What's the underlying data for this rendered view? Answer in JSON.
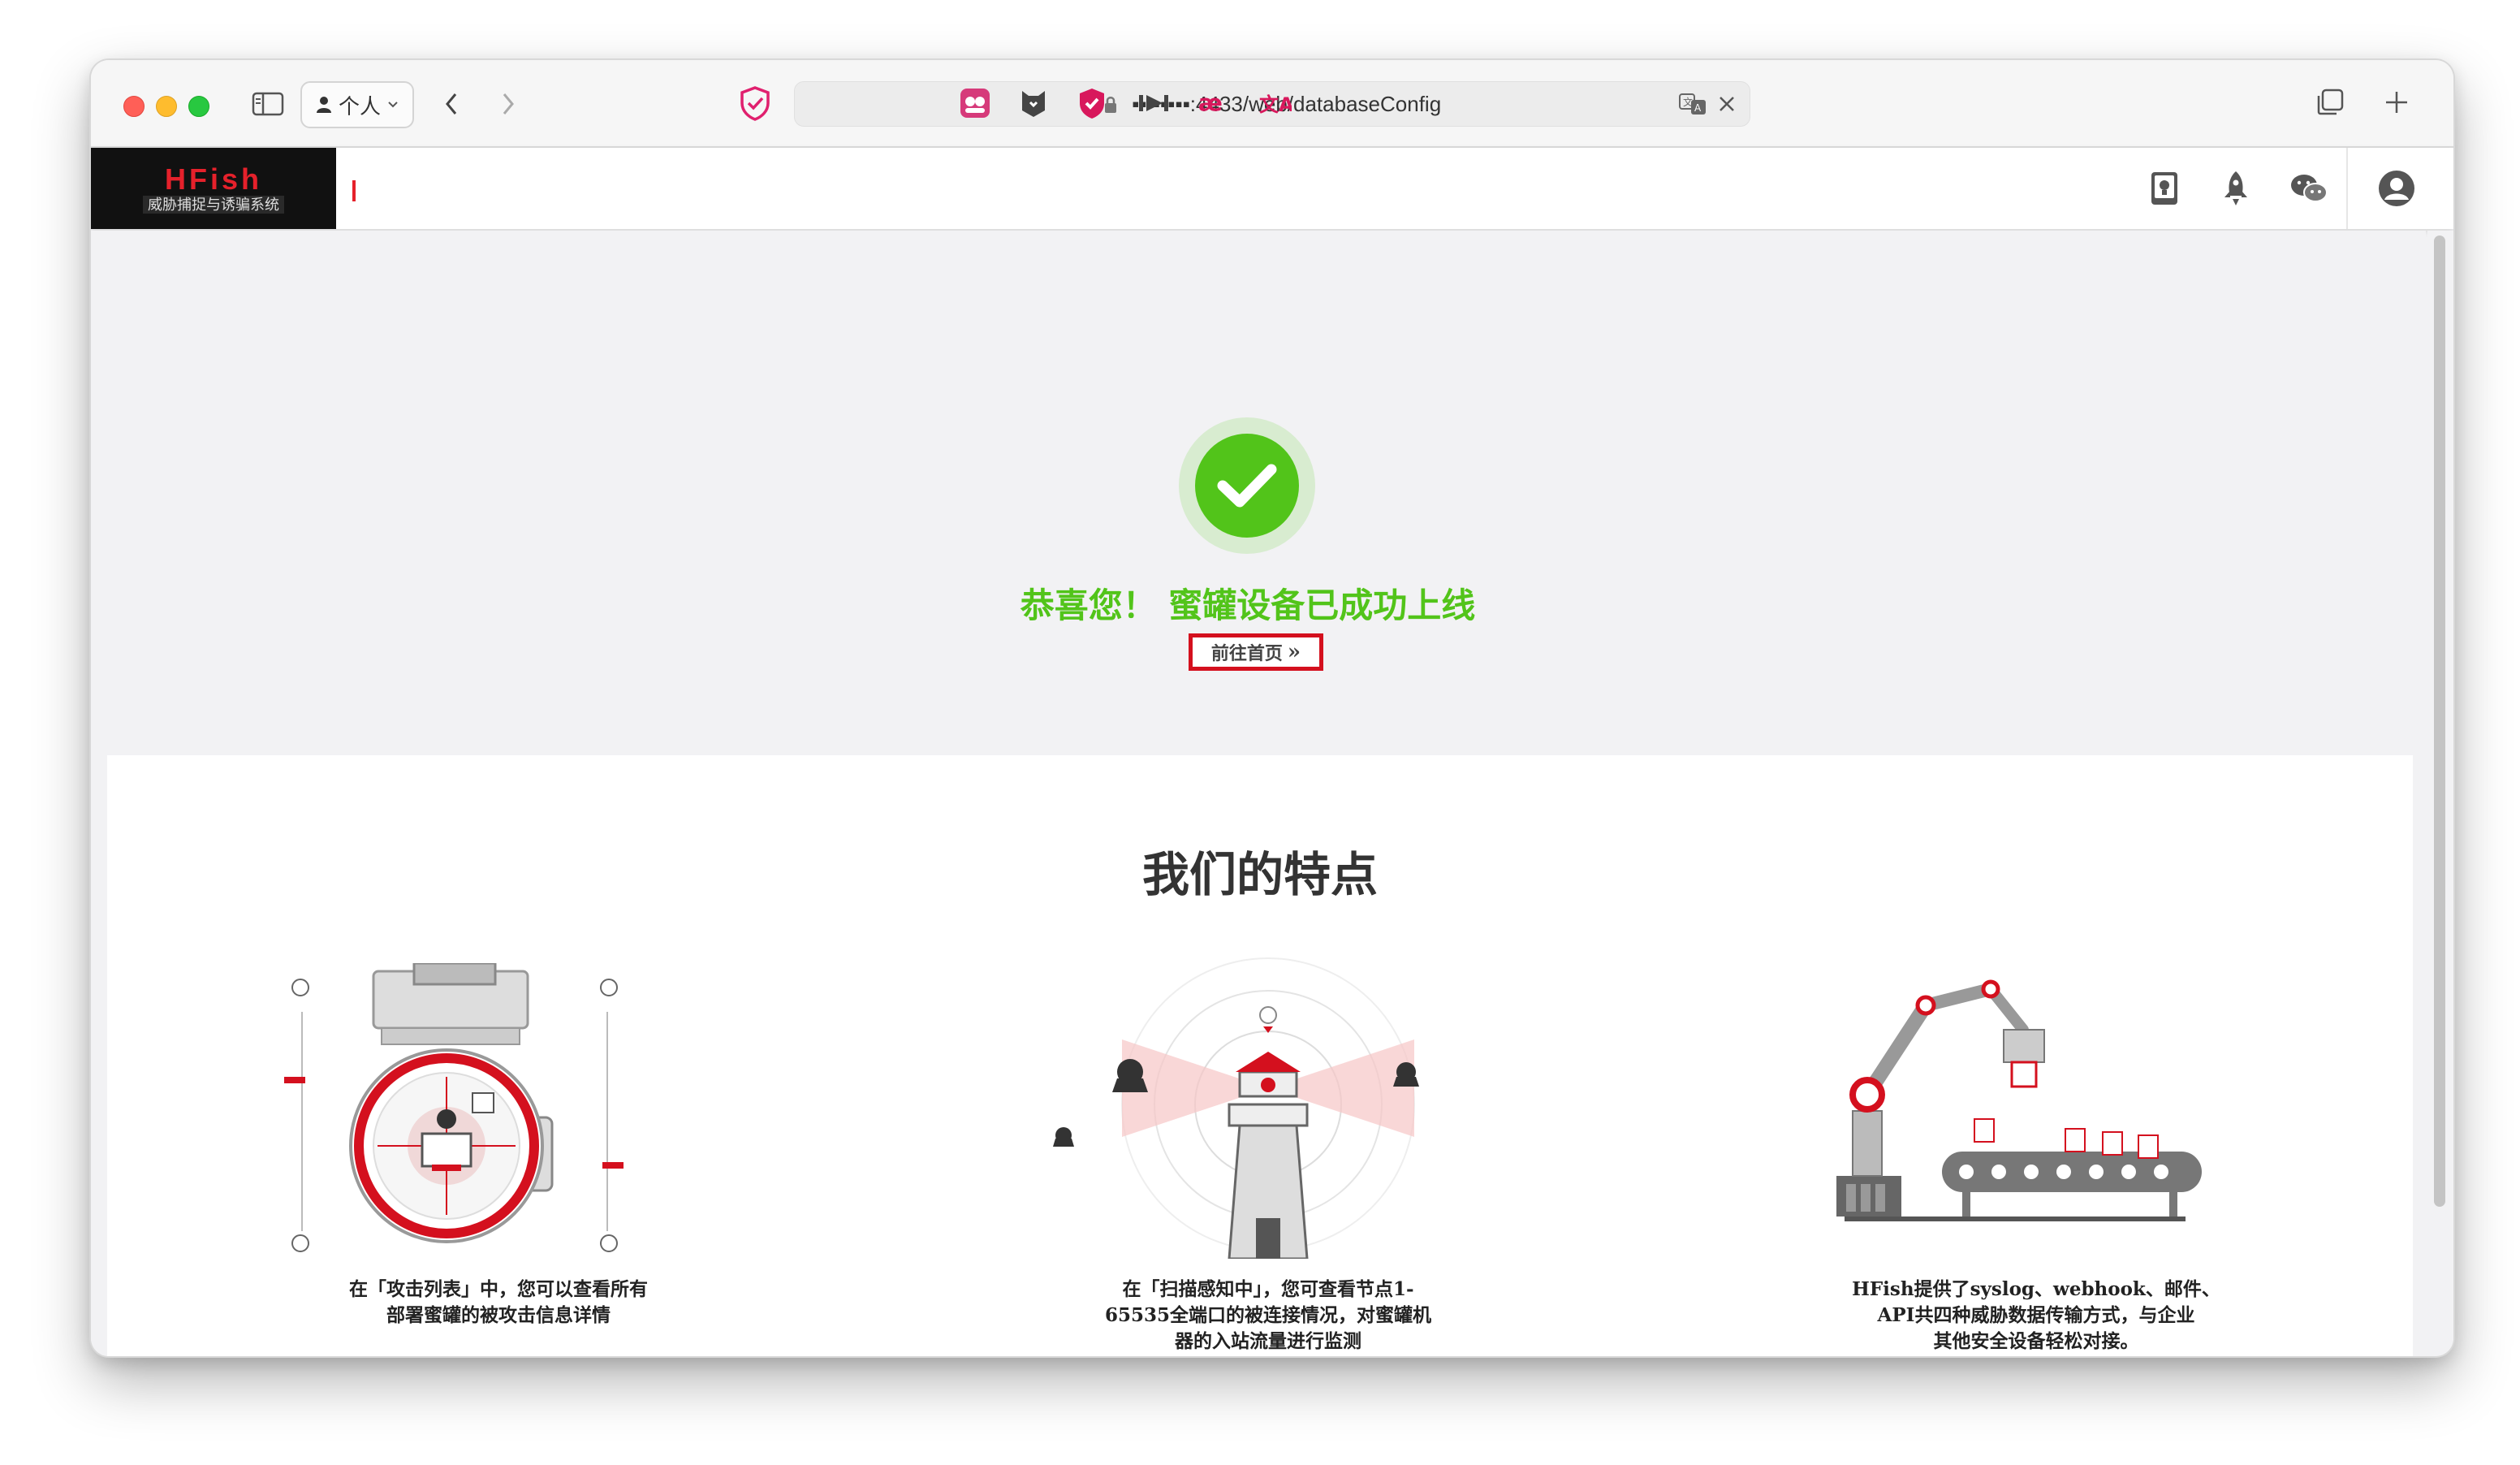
{
  "browser": {
    "profile_label": "个人",
    "url": "▪︎▪︎  ▪︎▪︎▪︎▪︎▪︎:4433/web/databaseConfig"
  },
  "app": {
    "logo_title": "HFish",
    "logo_subtitle": "威胁捕捉与诱骗系统"
  },
  "success": {
    "title": "恭喜您！ 蜜罐设备已成功上线",
    "home_button": "前往首页",
    "home_button_arrow": "»",
    "color": "#52c41a"
  },
  "features": {
    "title": "我们的特点",
    "items": [
      {
        "lines": [
          "在「攻击列表」中，您可以查看所有",
          "部署蜜罐的被攻击信息详情"
        ]
      },
      {
        "lines": [
          "在「扫描感知中」，您可查看节点1-",
          "65535全端口的被连接情况，对蜜罐机",
          "器的入站流量进行监测"
        ]
      },
      {
        "lines": [
          "HFish提供了syslog、webhook、邮件、",
          "API共四种威胁数据传输方式，与企业",
          "其他安全设备轻松对接。"
        ]
      }
    ]
  },
  "colors": {
    "brand_red": "#e5212b",
    "success_green": "#52c41a"
  }
}
